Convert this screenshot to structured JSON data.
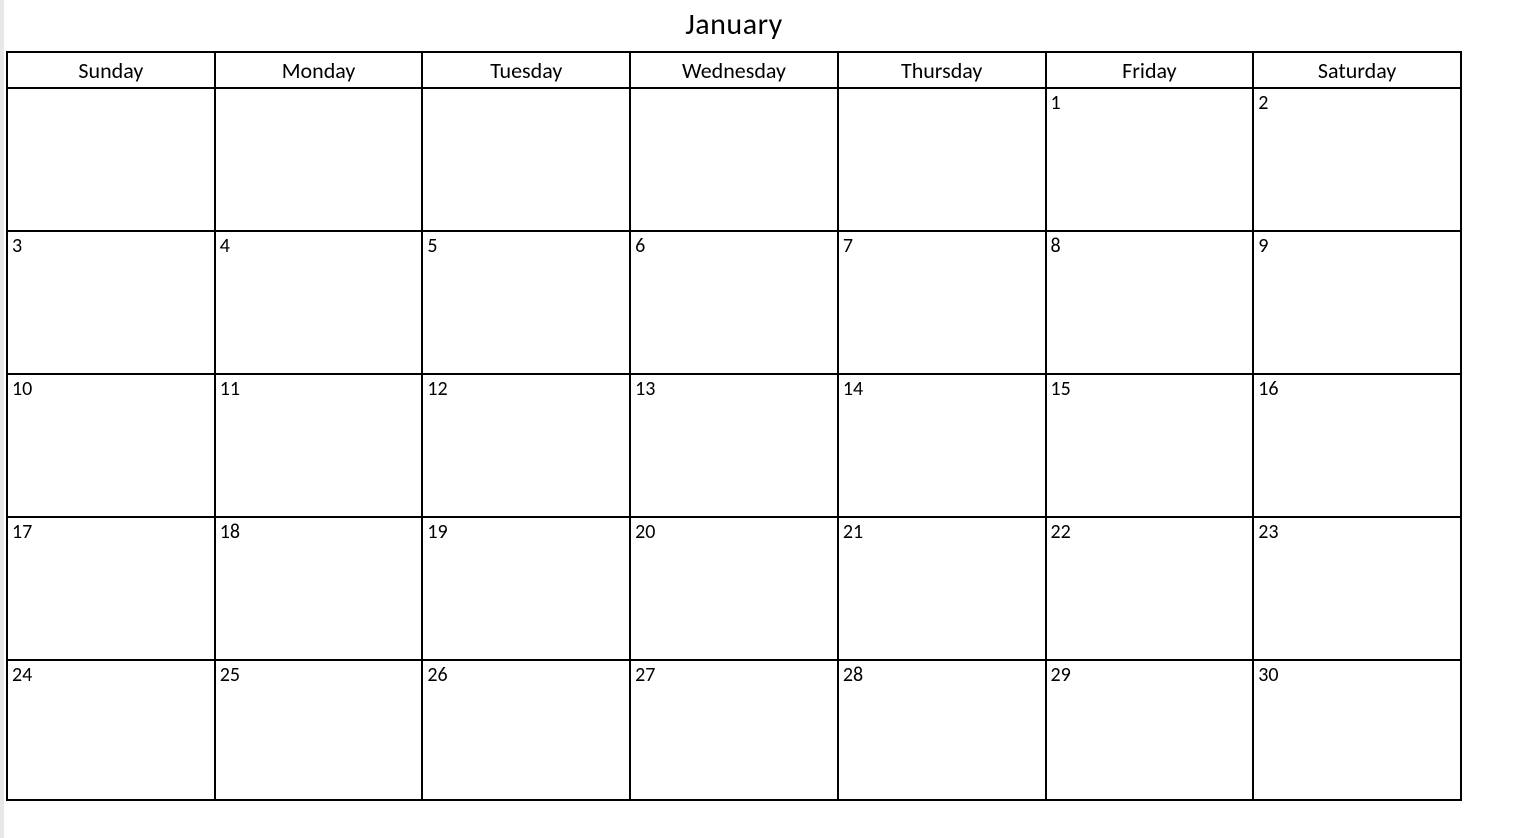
{
  "calendar": {
    "month_title": "January",
    "day_headers": [
      "Sunday",
      "Monday",
      "Tuesday",
      "Wednesday",
      "Thursday",
      "Friday",
      "Saturday"
    ],
    "weeks": [
      [
        "",
        "",
        "",
        "",
        "",
        "1",
        "2"
      ],
      [
        "3",
        "4",
        "5",
        "6",
        "7",
        "8",
        "9"
      ],
      [
        "10",
        "11",
        "12",
        "13",
        "14",
        "15",
        "16"
      ],
      [
        "17",
        "18",
        "19",
        "20",
        "21",
        "22",
        "23"
      ],
      [
        "24",
        "25",
        "26",
        "27",
        "28",
        "29",
        "30"
      ]
    ]
  }
}
